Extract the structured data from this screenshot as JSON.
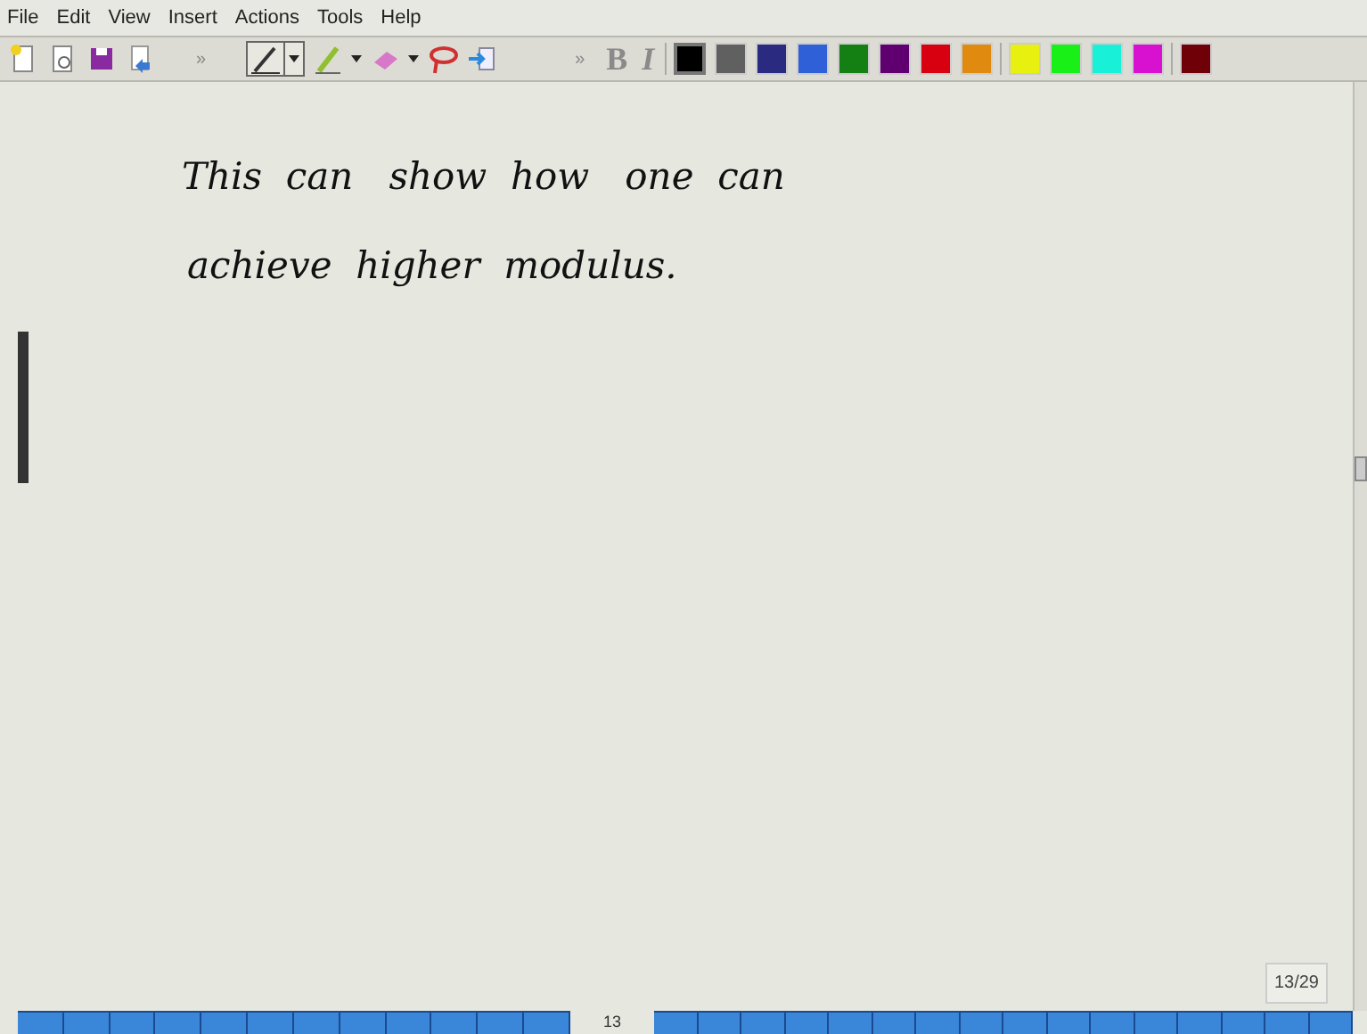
{
  "menu": [
    "File",
    "Edit",
    "View",
    "Insert",
    "Actions",
    "Tools",
    "Help"
  ],
  "toolbar": {
    "overflow_left": "»",
    "overflow_right": "»",
    "bold": "B",
    "italic": "I"
  },
  "palette": [
    {
      "color": "#000000",
      "selected": true
    },
    {
      "color": "#606060",
      "selected": false
    },
    {
      "color": "#2a2a80",
      "selected": false
    },
    {
      "color": "#3060d8",
      "selected": false
    },
    {
      "color": "#148014",
      "selected": false
    },
    {
      "color": "#600070",
      "selected": false
    },
    {
      "color": "#d80010",
      "selected": false
    },
    {
      "color": "#e08a10",
      "selected": false
    },
    {
      "color": "#e8f010",
      "selected": false
    },
    {
      "color": "#18f018",
      "selected": false
    },
    {
      "color": "#18f0d8",
      "selected": false
    },
    {
      "color": "#d810d0",
      "selected": false
    },
    {
      "color": "#700008",
      "selected": false
    }
  ],
  "ink": [
    "This  can   show  how   one  can",
    "achieve  higher  modulus."
  ],
  "page_counter": "13/29",
  "page_number": "13"
}
